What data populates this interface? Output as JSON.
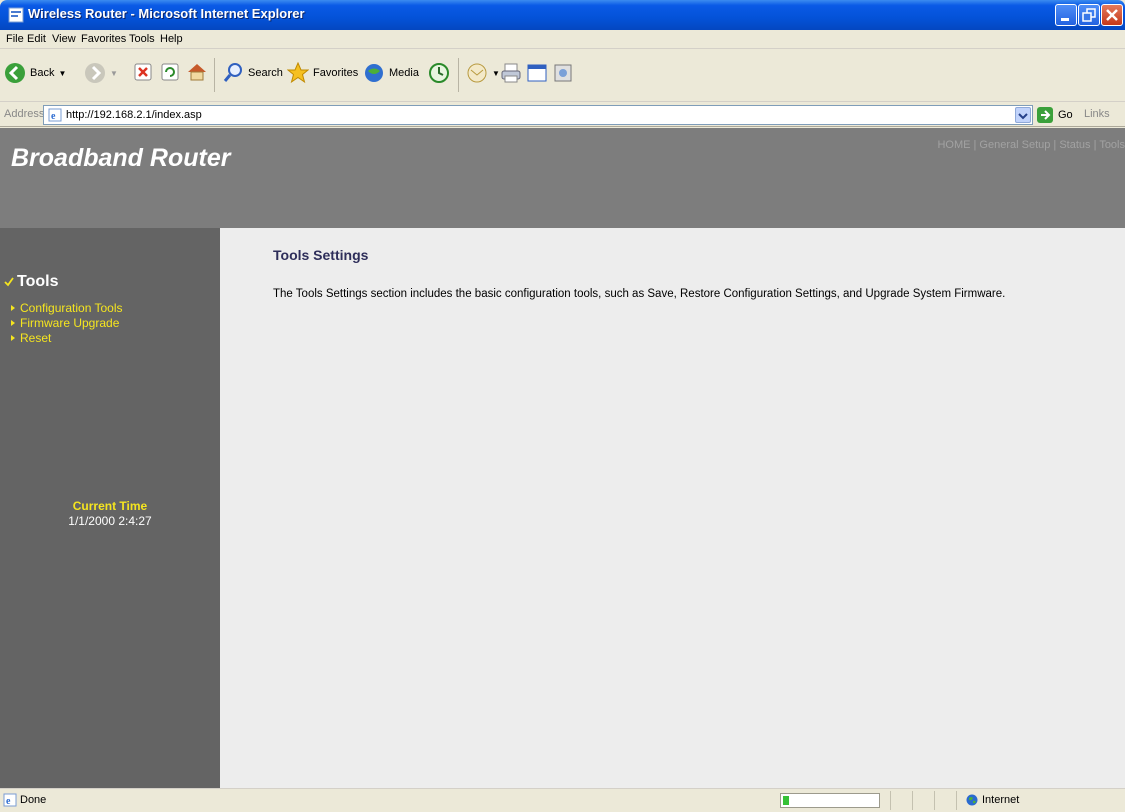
{
  "window": {
    "title": "Wireless Router - Microsoft Internet Explorer"
  },
  "menu": {
    "items": [
      "File",
      "Edit",
      "View",
      "Favorites",
      "Tools",
      "Help"
    ]
  },
  "toolbar": {
    "back_label": "Back",
    "search_label": "Search",
    "favorites_label": "Favorites",
    "media_label": "Media"
  },
  "address": {
    "label": "Address",
    "url": "http://192.168.2.1/index.asp",
    "go_label": "Go",
    "links_label": "Links"
  },
  "page": {
    "brand": "Broadband Router",
    "nav": [
      "HOME",
      "General Setup",
      "Status",
      "Tools"
    ],
    "nav_separator": " | ",
    "sidebar": {
      "title": "Tools",
      "links": [
        "Configuration Tools",
        "Firmware Upgrade",
        "Reset"
      ],
      "time_label": "Current Time",
      "time_value": "1/1/2000 2:4:27"
    },
    "main": {
      "title": "Tools Settings",
      "description": "The Tools Settings section includes the basic configuration tools, such as Save, Restore Configuration Settings, and Upgrade System Firmware."
    }
  },
  "statusbar": {
    "status": "Done",
    "progress": 0.15,
    "zone": "Internet"
  },
  "colors": {
    "banner": "#7D7D7D",
    "sidebar": "#646464",
    "link": "#F5E51F",
    "title": "#2E2E5A",
    "background": "#EDEDED"
  }
}
